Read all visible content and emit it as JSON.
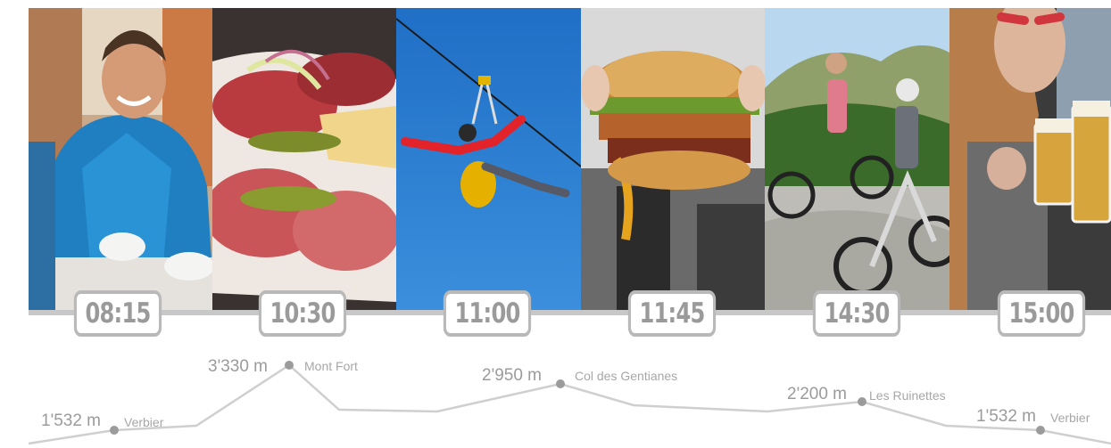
{
  "timeline": [
    {
      "time": "08:15",
      "photo": "man-at-cafe"
    },
    {
      "time": "10:30",
      "photo": "charcuterie-plate"
    },
    {
      "time": "11:00",
      "photo": "zipline-rider"
    },
    {
      "time": "11:45",
      "photo": "burger"
    },
    {
      "time": "14:30",
      "photo": "e-bike-riders"
    },
    {
      "time": "15:00",
      "photo": "beer-toast"
    }
  ],
  "profile": [
    {
      "elevation": "1'532 m",
      "place": "Verbier"
    },
    {
      "elevation": "3'330 m",
      "place": "Mont Fort"
    },
    {
      "elevation": "2'950 m",
      "place": "Col des Gentianes"
    },
    {
      "elevation": "2'200 m",
      "place": "Les Ruinettes"
    },
    {
      "elevation": "1'532 m",
      "place": "Verbier"
    }
  ]
}
